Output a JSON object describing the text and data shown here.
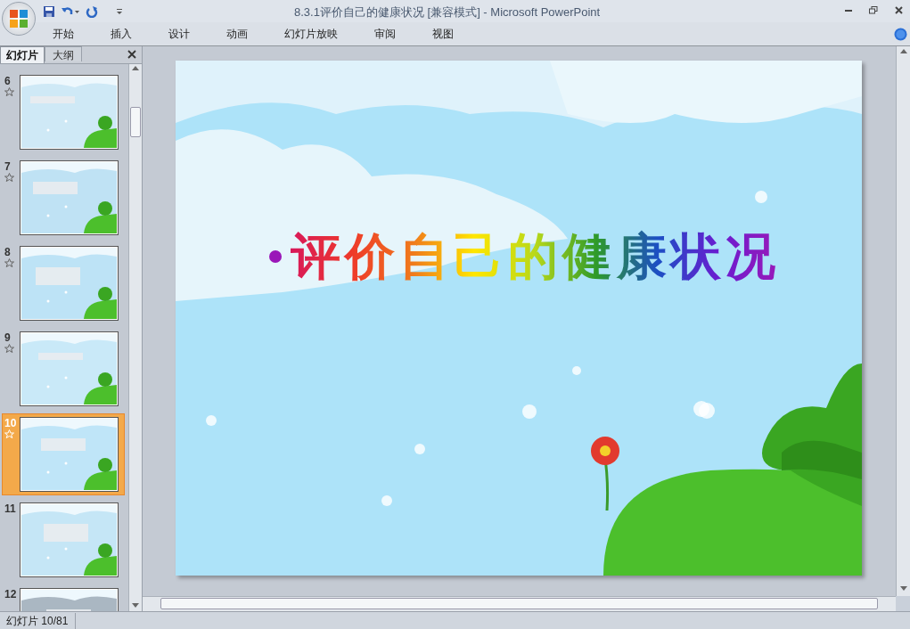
{
  "window": {
    "title": "8.3.1评价自己的健康状况 [兼容模式] - Microsoft PowerPoint"
  },
  "ribbon_tabs": [
    {
      "label": "开始"
    },
    {
      "label": "插入"
    },
    {
      "label": "设计"
    },
    {
      "label": "动画"
    },
    {
      "label": "幻灯片放映"
    },
    {
      "label": "审阅"
    },
    {
      "label": "视图"
    }
  ],
  "panel_tabs": [
    {
      "label": "幻灯片",
      "selected": true
    },
    {
      "label": "大纲",
      "selected": false
    }
  ],
  "slides": [
    {
      "number": "6",
      "has_animation": true,
      "selected": false
    },
    {
      "number": "7",
      "has_animation": true,
      "selected": false
    },
    {
      "number": "8",
      "has_animation": true,
      "selected": false
    },
    {
      "number": "9",
      "has_animation": true,
      "selected": false
    },
    {
      "number": "10",
      "has_animation": true,
      "selected": true
    },
    {
      "number": "11",
      "has_animation": false,
      "selected": false
    },
    {
      "number": "12",
      "has_animation": false,
      "selected": false
    }
  ],
  "slide": {
    "title": "评价自己的健康状况"
  },
  "status_bar": {
    "slide_position": "幻灯片 10/81"
  }
}
